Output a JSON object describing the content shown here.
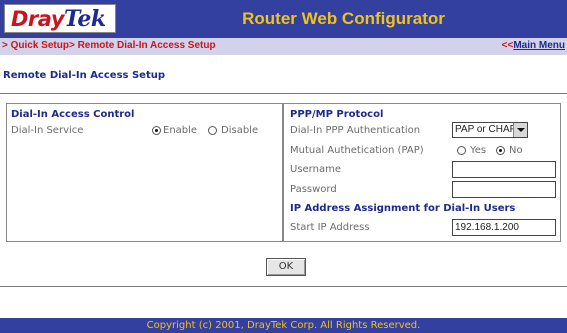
{
  "header": {
    "logo_dray": "Dray",
    "logo_tek": "Tek",
    "title": "Router Web Configurator"
  },
  "breadcrumb": {
    "path": "> Quick Setup> Remote Dial-In Access Setup",
    "main_menu_prefix": "<<",
    "main_menu_label": "Main Menu"
  },
  "page_title": "Remote Dial-In Access Setup",
  "left_panel": {
    "heading": "Dial-In Access Control",
    "dial_in_service_label": "Dial-In Service",
    "options": [
      "Enable",
      "Disable"
    ],
    "selected": "Enable"
  },
  "right_panel": {
    "heading": "PPP/MP Protocol",
    "auth_label": "Dial-In PPP Authentication",
    "auth_value": "PAP or CHAP",
    "mutual_label": "Mutual Authetication (PAP)",
    "mutual_options": [
      "Yes",
      "No"
    ],
    "mutual_selected": "No",
    "username_label": "Username",
    "username_value": "",
    "password_label": "Password",
    "password_value": "",
    "ip_heading": "IP Address Assignment for Dial-In Users",
    "start_ip_label": "Start IP Address",
    "start_ip_value": "192.168.1.200"
  },
  "ok_label": "OK",
  "footer": "Copyright (c) 2001, DrayTek Corp. All Rights Reserved.",
  "colors": {
    "header_bg": "#3340a0",
    "title_yellow": "#f0c21c",
    "crumb_bg": "#d2d2ea",
    "crumb_red": "#c8161e",
    "heading_blue": "#1e2a8c"
  }
}
